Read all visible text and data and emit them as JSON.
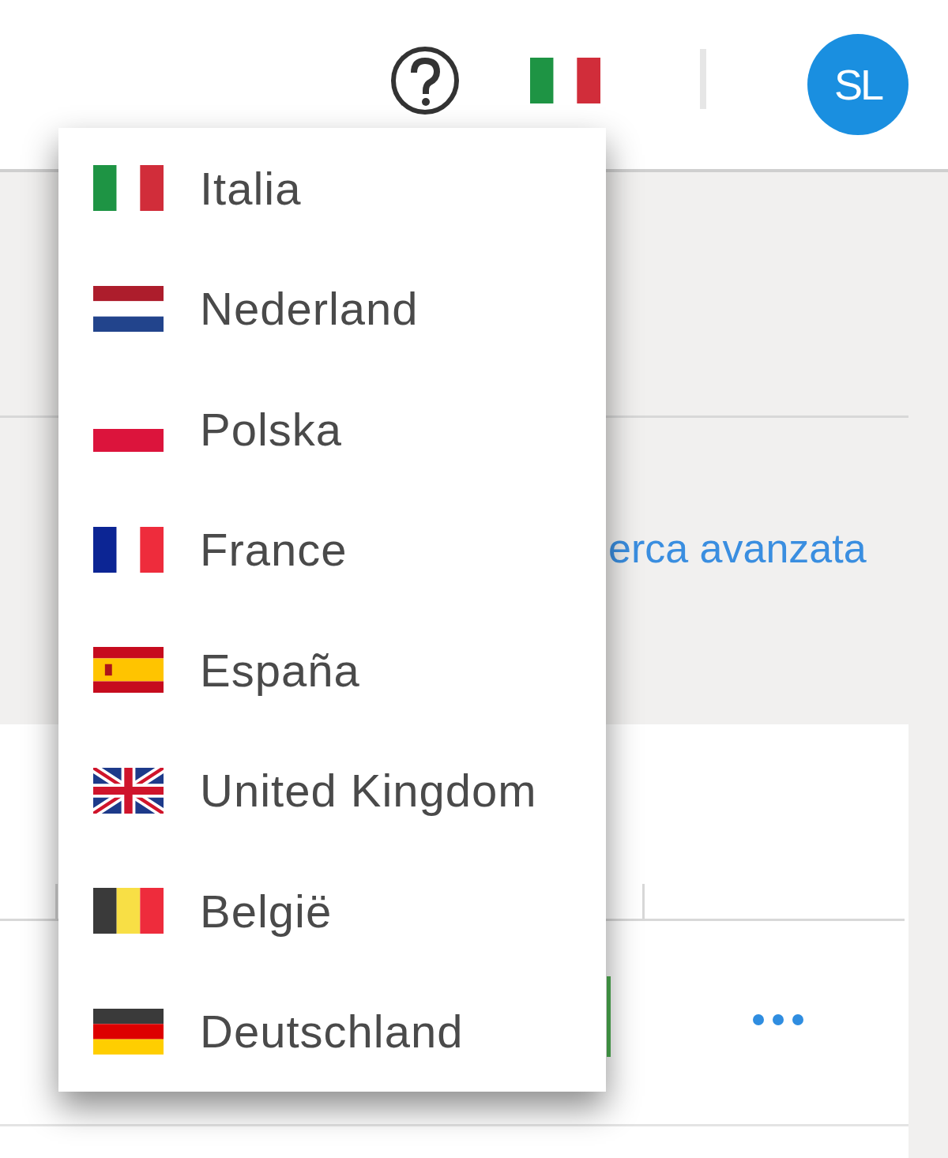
{
  "header": {
    "language_flag": {
      "kind": "italy"
    },
    "avatar": {
      "initials": "SL"
    }
  },
  "search": {
    "advanced_link": "erca avanzata"
  },
  "language_menu": {
    "items": [
      {
        "label": "Italia",
        "kind": "italy"
      },
      {
        "label": "Nederland",
        "kind": "netherlands"
      },
      {
        "label": "Polska",
        "kind": "poland"
      },
      {
        "label": "France",
        "kind": "france"
      },
      {
        "label": "España",
        "kind": "spain"
      },
      {
        "label": "United Kingdom",
        "kind": "uk"
      },
      {
        "label": "België",
        "kind": "belgium"
      },
      {
        "label": "Deutschland",
        "kind": "germany"
      }
    ]
  }
}
